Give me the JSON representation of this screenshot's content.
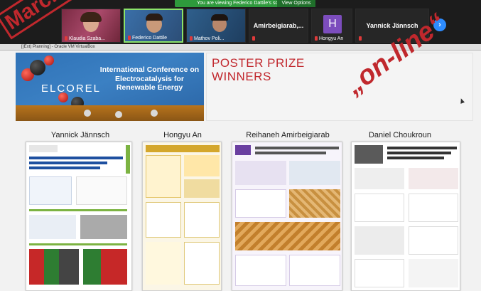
{
  "zoom": {
    "share_banner": "You are viewing Federico Dattile's screen",
    "view_options": "View Options",
    "participants": [
      {
        "name": "Klaudia Szaba...",
        "kind": "video"
      },
      {
        "name": "Federico Dattile",
        "kind": "video"
      },
      {
        "name": "Mathov Poli...",
        "kind": "video"
      },
      {
        "name": "Amirbeigiarab,...",
        "kind": "text"
      },
      {
        "name": "Hongyu An",
        "kind": "avatar",
        "initial": "H"
      },
      {
        "name": "Yannick Jännsch",
        "kind": "text"
      }
    ],
    "next_icon": "chevron-right-icon"
  },
  "vm_window": {
    "title": "[(Ext) Planning] - Oracle VM VirtualBox"
  },
  "slide": {
    "conference_title": "International Conference on Electrocatalysis for Renewable Energy",
    "logo_text": "ELCOREL",
    "heading": "POSTER PRIZE WINNERS",
    "presenters": [
      "Yannick Jännsch",
      "Hongyu An",
      "Reihaneh Amirbeigiarab",
      "Daniel Choukroun"
    ]
  },
  "overlays": {
    "left_stamp": "March...",
    "right_stamp": "„on-line“"
  },
  "colors": {
    "accent_red": "#c0282d",
    "zoom_green": "#2e9a3c",
    "zoom_blue": "#2d8cff",
    "banner_blue": "#2f72b7"
  }
}
